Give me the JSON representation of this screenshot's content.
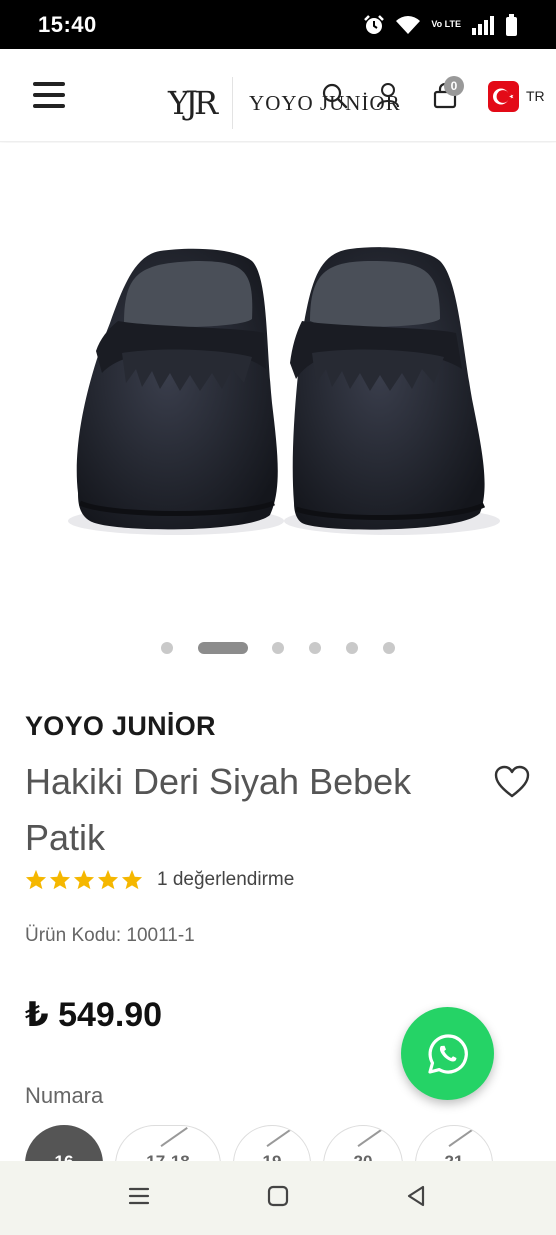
{
  "status_bar": {
    "time": "15:40",
    "network": "Vo LTE"
  },
  "header": {
    "logo_mark": "YJR",
    "logo_text": "YOYO JUNİOR",
    "cart_count": "0",
    "language": "TR"
  },
  "carousel": {
    "total": 6,
    "active_index": 1
  },
  "product": {
    "brand": "YOYO JUNİOR",
    "title": "Hakiki Deri Siyah Bebek Patik",
    "rating": 5,
    "rating_max": 5,
    "reviews_text": "1 değerlendirme",
    "sku_text": "Ürün Kodu: 10011-1",
    "price": "₺ 549.90"
  },
  "size_selector": {
    "label": "Numara",
    "options": [
      {
        "label": "16",
        "selected": true,
        "available": true
      },
      {
        "label": "17-18",
        "selected": false,
        "available": false
      },
      {
        "label": "19",
        "selected": false,
        "available": false
      },
      {
        "label": "20",
        "selected": false,
        "available": false
      },
      {
        "label": "21",
        "selected": false,
        "available": false
      }
    ]
  },
  "colors": {
    "accent_whatsapp": "#25d366",
    "star": "#f5b700",
    "flag_red": "#e30a17",
    "selected_chip": "#555555"
  },
  "icons": {
    "menu": "hamburger-menu-icon",
    "search": "search-icon",
    "user": "user-icon",
    "cart": "shopping-bag-icon",
    "favorite": "heart-icon",
    "whatsapp": "whatsapp-icon",
    "nav_recents": "recent-apps-icon",
    "nav_home": "home-icon",
    "nav_back": "back-icon"
  }
}
